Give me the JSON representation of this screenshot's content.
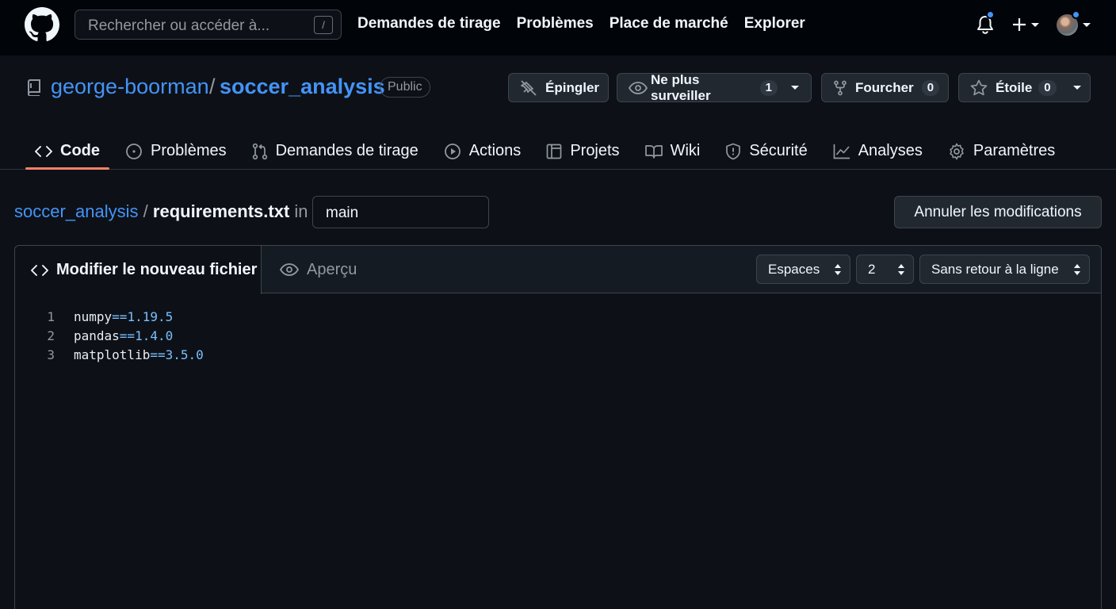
{
  "header": {
    "search_placeholder": "Rechercher ou accéder à...",
    "search_shortcut": "/",
    "nav": [
      "Demandes de tirage",
      "Problèmes",
      "Place de marché",
      "Explorer"
    ]
  },
  "repo": {
    "owner": "george-boorman",
    "separator": "/",
    "name": "soccer_analysis",
    "visibility": "Public",
    "actions": {
      "pin": {
        "label": "Épingler"
      },
      "watch": {
        "label": "Ne plus surveiller",
        "count": "1"
      },
      "fork": {
        "label": "Fourcher",
        "count": "0"
      },
      "star": {
        "label": "Étoile",
        "count": "0"
      }
    },
    "tabs": [
      {
        "label": "Code",
        "icon": "code-icon",
        "active": true
      },
      {
        "label": "Problèmes",
        "icon": "issue-icon"
      },
      {
        "label": "Demandes de tirage",
        "icon": "pull-request-icon"
      },
      {
        "label": "Actions",
        "icon": "play-icon"
      },
      {
        "label": "Projets",
        "icon": "project-icon"
      },
      {
        "label": "Wiki",
        "icon": "book-icon"
      },
      {
        "label": "Sécurité",
        "icon": "shield-icon"
      },
      {
        "label": "Analyses",
        "icon": "graph-icon"
      },
      {
        "label": "Paramètres",
        "icon": "gear-icon"
      }
    ]
  },
  "file": {
    "repo_link": "soccer_analysis",
    "separator": "/",
    "filename": "requirements.txt",
    "in_label": "in",
    "branch": "main",
    "cancel_label": "Annuler les modifications"
  },
  "editor": {
    "tab_edit": "Modifier le nouveau fichier",
    "tab_preview": "Aperçu",
    "indent_mode": "Espaces",
    "indent_size": "2",
    "wrap_mode": "Sans retour à la ligne",
    "lines": [
      {
        "num": "1",
        "pkg": "numpy",
        "op": "==",
        "ver": "1.19.5"
      },
      {
        "num": "2",
        "pkg": "pandas",
        "op": "==",
        "ver": "1.4.0"
      },
      {
        "num": "3",
        "pkg": "matplotlib",
        "op": "==",
        "ver": "3.5.0"
      }
    ]
  },
  "colors": {
    "accent_link": "#4493f8",
    "tab_underline": "#f78166",
    "background": "#0d1117",
    "topbar": "#010409"
  }
}
